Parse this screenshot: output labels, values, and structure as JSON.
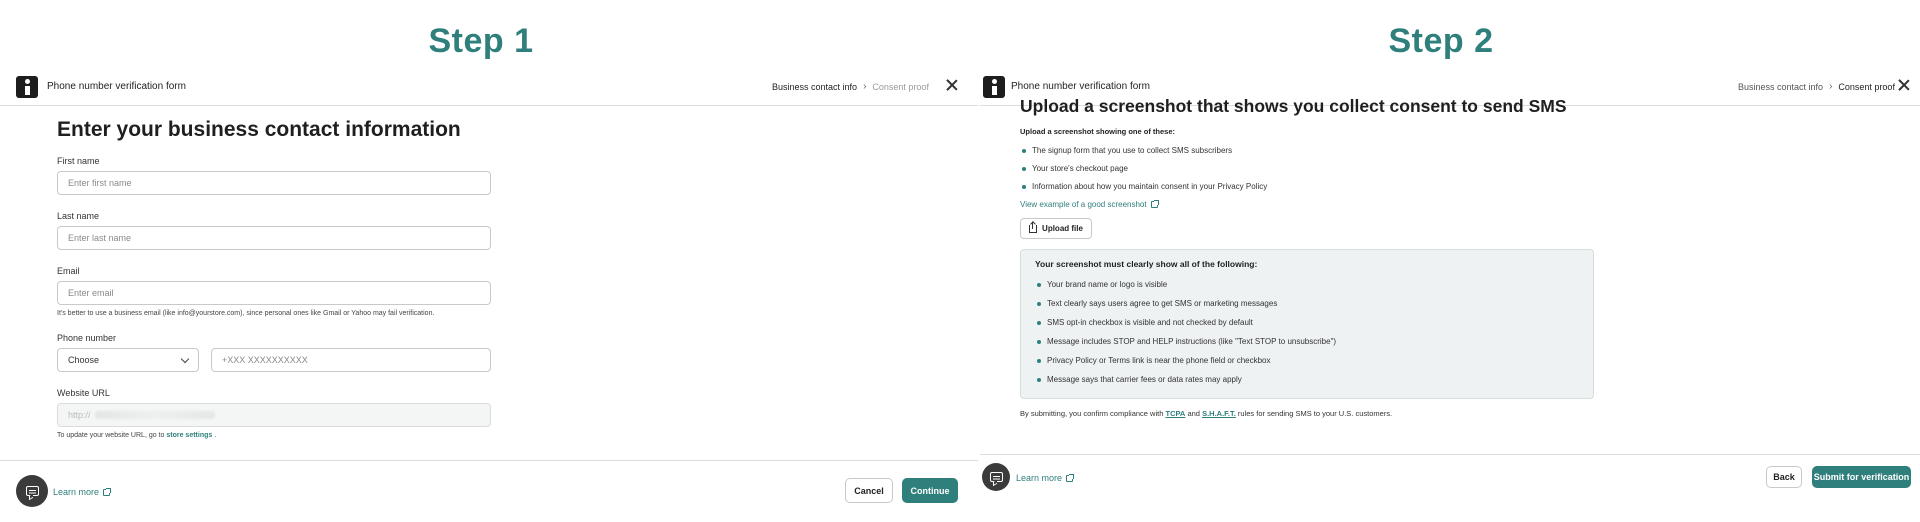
{
  "step1": {
    "title": "Step 1",
    "header": {
      "title": "Phone number verification form",
      "breadcrumb_current": "Business contact info",
      "breadcrumb_next": "Consent proof",
      "breadcrumb_sep": "›"
    },
    "heading": "Enter your business contact information",
    "first_name": {
      "label": "First name",
      "placeholder": "Enter first name"
    },
    "last_name": {
      "label": "Last name",
      "placeholder": "Enter last name"
    },
    "email": {
      "label": "Email",
      "placeholder": "Enter email",
      "helper": "It's better to use a business email (like info@yourstore.com), since personal ones like Gmail or Yahoo may fail verification."
    },
    "phone": {
      "label": "Phone number",
      "country_value": "Choose",
      "placeholder": "+XXX XXXXXXXXXX"
    },
    "website": {
      "label": "Website URL",
      "value_prefix": "http://",
      "helper_prefix": "To update your website URL, go to",
      "helper_link": "store settings",
      "helper_suffix": "."
    },
    "footer": {
      "learn_more": "Learn more",
      "cancel": "Cancel",
      "continue": "Continue"
    }
  },
  "step2": {
    "title": "Step 2",
    "header": {
      "title": "Phone number verification form",
      "breadcrumb_prev": "Business contact info",
      "breadcrumb_current": "Consent proof",
      "breadcrumb_sep": "›"
    },
    "heading": "Upload a screenshot that shows you collect consent to send SMS",
    "intro": "Upload a screenshot showing one of these:",
    "options": [
      "The signup form that you use to collect SMS subscribers",
      "Your store's checkout page",
      "Information about how you maintain consent in your Privacy Policy"
    ],
    "example_link": "View example of a good screenshot",
    "upload_button": "Upload file",
    "requirements_title": "Your screenshot must clearly show all of the following:",
    "requirements": [
      "Your brand name or logo is visible",
      "Text clearly says users agree to get SMS or marketing messages",
      "SMS opt-in checkbox is visible and not checked by default",
      "Message includes STOP and HELP instructions (like \"Text STOP to unsubscribe\")",
      "Privacy Policy or Terms link is near the phone field or checkbox",
      "Message says that carrier fees or data rates may apply"
    ],
    "compliance": {
      "prefix": "By submitting, you confirm compliance with",
      "tcpa": "TCPA",
      "and": "and",
      "shaft": "S.H.A.F.T.",
      "suffix": "rules for sending SMS to your U.S. customers."
    },
    "footer": {
      "learn_more": "Learn more",
      "back": "Back",
      "submit": "Submit for verification"
    }
  },
  "colors": {
    "accent": "#2f7f7c",
    "dark": "#1d1d1d",
    "callout_bg": "#eef2f2"
  }
}
